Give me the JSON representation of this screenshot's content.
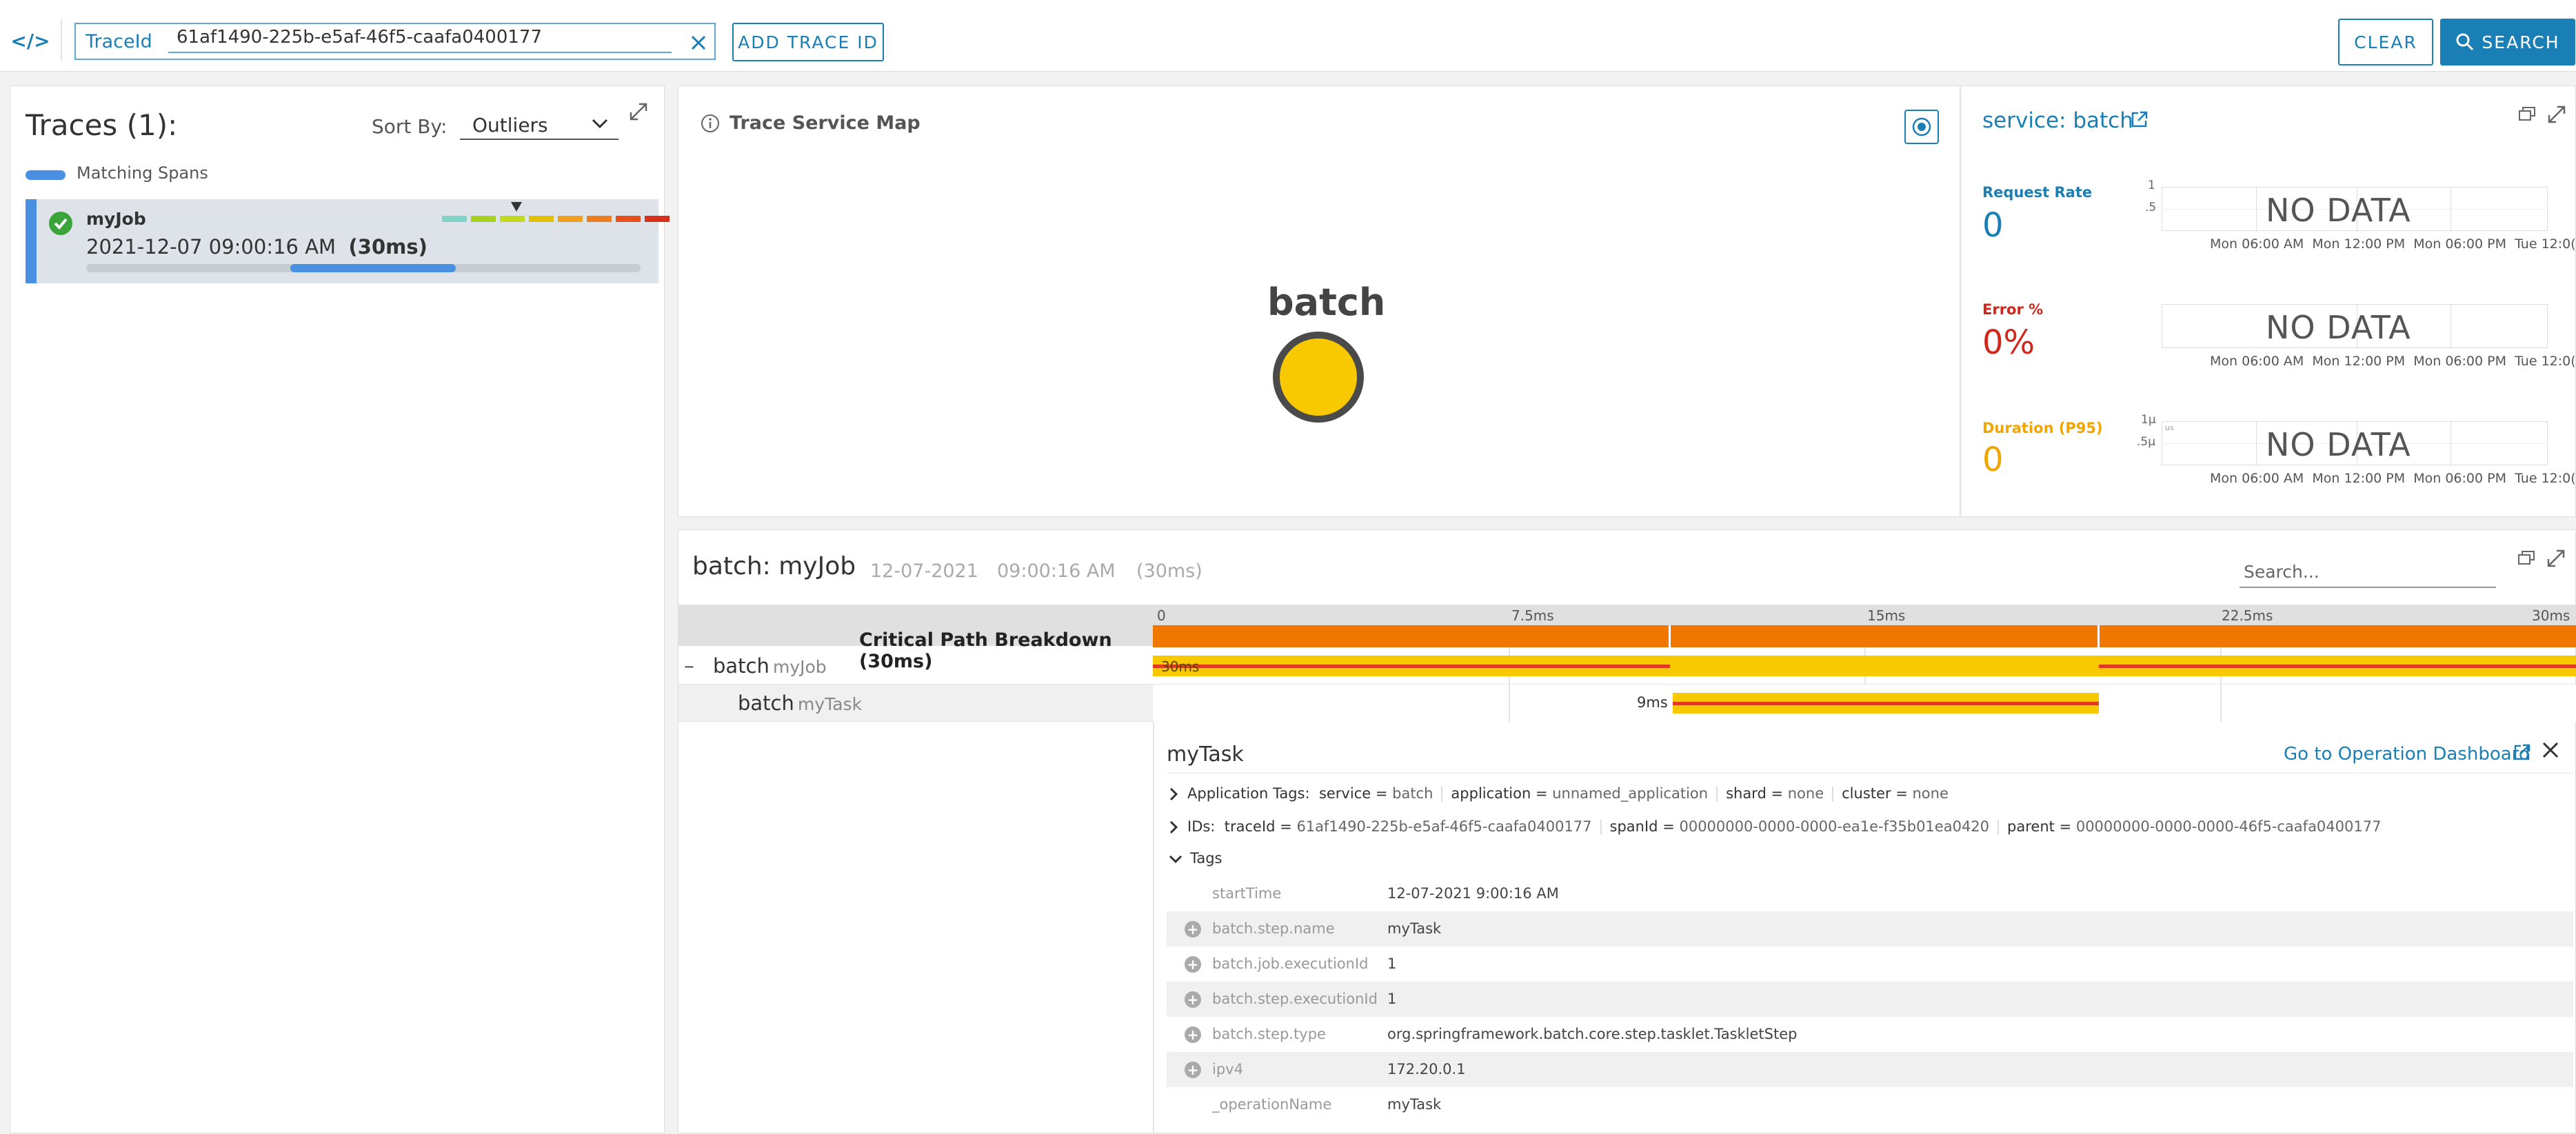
{
  "colors": {
    "accent": "#1a7fb4",
    "error": "#d0271d",
    "duration": "#f0a500",
    "node": "#f8c800",
    "critical": "#f07800",
    "span": "#f8c800",
    "span_red": "#e23a1e",
    "matching": "#4a90e2"
  },
  "topbar": {
    "code_label": "</>",
    "trace_field_label": "TraceId",
    "trace_field_value": "61af1490-225b-e5af-46f5-caafa0400177",
    "clear_icon": "close-icon",
    "add_trace_label": "ADD TRACE ID",
    "clear_label": "CLEAR",
    "search_label": "SEARCH"
  },
  "traces": {
    "title": "Traces (1):",
    "sort_label": "Sort By:",
    "sort_value": "Outliers",
    "legend": "Matching Spans",
    "items": [
      {
        "name": "myJob",
        "date": "2021-12-07 09:00:16 AM",
        "duration": "(30ms)",
        "heat": [
          "#7fd3c7",
          "#a8d020",
          "#c4d81e",
          "#e0c000",
          "#f0a020",
          "#ef7d22",
          "#e8501e",
          "#d9301a"
        ]
      }
    ]
  },
  "service_map": {
    "title": "Trace Service Map",
    "node_label": "batch"
  },
  "service_panel": {
    "title": "service: batch",
    "ticks": [
      "Mon 06:00 AM",
      "Mon 12:00 PM",
      "Mon 06:00 PM",
      "Tue 12:0("
    ],
    "metrics": [
      {
        "label": "Request Rate",
        "value": "0",
        "nodata": "NO DATA",
        "y_ticks": [
          "1",
          ".5"
        ]
      },
      {
        "label": "Error %",
        "value": "0%",
        "nodata": "NO DATA",
        "y_ticks": []
      },
      {
        "label": "Duration (P95)",
        "value": "0",
        "nodata": "NO DATA",
        "y_ticks": [
          "1μ",
          ".5μ"
        ],
        "y_small": "us"
      }
    ]
  },
  "trace_detail": {
    "title": "batch: myJob",
    "date": "12-07-2021",
    "time": "09:00:16 AM",
    "duration": "(30ms)",
    "search_placeholder": "Search...",
    "critical_label": "Critical Path Breakdown (30ms)",
    "scale_ticks": [
      "0",
      "7.5ms",
      "15ms",
      "22.5ms",
      "30ms"
    ],
    "rows": [
      {
        "minus": "–",
        "service": "batch",
        "operation": "myJob",
        "bar_label": "30ms"
      },
      {
        "service": "batch",
        "operation": "myTask",
        "bar_label": "9ms"
      }
    ]
  },
  "span_details": {
    "title": "myTask",
    "dashboard_link": "Go to Operation Dashboard",
    "app_tags_label": "Application Tags:",
    "app_tags": [
      {
        "k": "service",
        "v": "batch"
      },
      {
        "k": "application",
        "v": "unnamed_application"
      },
      {
        "k": "shard",
        "v": "none"
      },
      {
        "k": "cluster",
        "v": "none"
      }
    ],
    "ids_label": "IDs:",
    "ids": [
      {
        "k": "traceId",
        "v": "61af1490-225b-e5af-46f5-caafa0400177"
      },
      {
        "k": "spanId",
        "v": "00000000-0000-0000-ea1e-f35b01ea0420"
      },
      {
        "k": "parent",
        "v": "00000000-0000-0000-46f5-caafa0400177"
      }
    ],
    "tags_label": "Tags",
    "tags": [
      {
        "key": "startTime",
        "value": "12-07-2021 9:00:16 AM"
      },
      {
        "key": "batch.step.name",
        "value": "myTask"
      },
      {
        "key": "batch.job.executionId",
        "value": "1"
      },
      {
        "key": "batch.step.executionId",
        "value": "1"
      },
      {
        "key": "batch.step.type",
        "value": "org.springframework.batch.core.step.tasklet.TaskletStep"
      },
      {
        "key": "ipv4",
        "value": "172.20.0.1"
      },
      {
        "key": "_operationName",
        "value": "myTask"
      }
    ]
  }
}
